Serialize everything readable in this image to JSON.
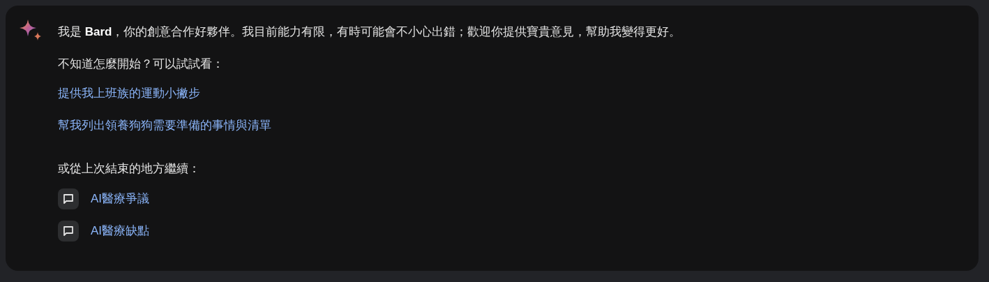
{
  "intro": "我是 **Bard**，你的創意合作好夥伴。我目前能力有限，有時可能會不小心出錯；歡迎你提供寶貴意見，幫助我變得更好。",
  "prompt_heading": "不知道怎麼開始？可以試試看：",
  "suggestions": [
    "提供我上班族的運動小撇步",
    "幫我列出領養狗狗需要準備的事情與清單"
  ],
  "recent_heading": "或從上次結束的地方繼續：",
  "recent_chats": [
    {
      "title": "AI醫療爭議"
    },
    {
      "title": "AI醫療缺點"
    }
  ]
}
